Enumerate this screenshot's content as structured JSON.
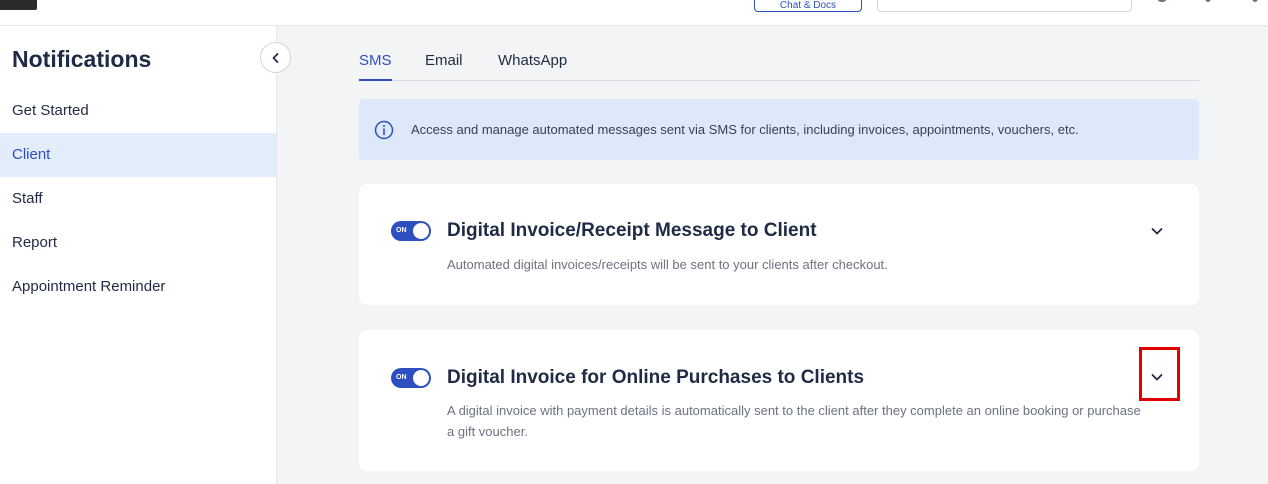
{
  "topbar": {
    "chat_docs_label": "Chat & Docs"
  },
  "sidebar": {
    "title": "Notifications",
    "items": [
      {
        "label": "Get Started",
        "active": false
      },
      {
        "label": "Client",
        "active": true
      },
      {
        "label": "Staff",
        "active": false
      },
      {
        "label": "Report",
        "active": false
      },
      {
        "label": "Appointment Reminder",
        "active": false
      }
    ]
  },
  "tabs": [
    {
      "label": "SMS",
      "active": true
    },
    {
      "label": "Email",
      "active": false
    },
    {
      "label": "WhatsApp",
      "active": false
    }
  ],
  "info_banner": {
    "icon": "info-icon",
    "text": "Access and manage automated messages sent via SMS for clients, including invoices, appointments, vouchers, etc."
  },
  "cards": [
    {
      "toggle_label": "ON",
      "enabled": true,
      "title": "Digital Invoice/Receipt Message to Client",
      "description": "Automated digital invoices/receipts will be sent to your clients after checkout."
    },
    {
      "toggle_label": "ON",
      "enabled": true,
      "title": "Digital Invoice for Online Purchases to Clients",
      "description": "A digital invoice with payment details is automatically sent to the client after they complete an online booking or purchase a gift voucher."
    }
  ],
  "colors": {
    "accent": "#2d4fbf",
    "active_nav_bg": "#e3ecfb",
    "banner_bg": "#dde9fb",
    "highlight": "#e00000"
  }
}
